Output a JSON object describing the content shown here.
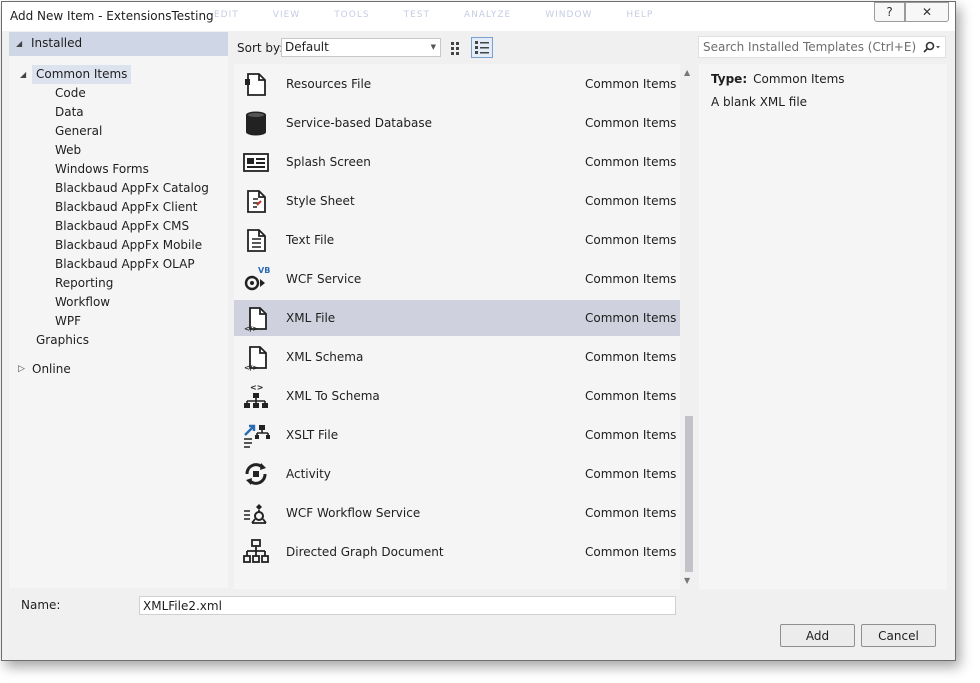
{
  "window": {
    "title": "Add New Item - ExtensionsTesting",
    "ghost_menu": [
      "EDIT",
      "VIEW",
      "TOOLS",
      "TEST",
      "ANALYZE",
      "WINDOW",
      "HELP"
    ],
    "help_label": "?",
    "close_label": "✕"
  },
  "tree": {
    "installed": "Installed",
    "common_items": "Common Items",
    "children": [
      "Code",
      "Data",
      "General",
      "Web",
      "Windows Forms",
      "Blackbaud AppFx Catalog",
      "Blackbaud AppFx Client",
      "Blackbaud AppFx CMS",
      "Blackbaud AppFx Mobile",
      "Blackbaud AppFx OLAP",
      "Reporting",
      "Workflow",
      "WPF"
    ],
    "graphics": "Graphics",
    "online": "Online"
  },
  "toolbar": {
    "sort_label": "Sort by:",
    "sort_value": "Default",
    "view_modes": [
      "small-icons-view-icon",
      "list-view-icon"
    ],
    "active_view": "list-view-icon"
  },
  "search": {
    "placeholder": "Search Installed Templates (Ctrl+E)"
  },
  "templates": [
    {
      "name": "Resources File",
      "category": "Common Items",
      "icon": "resources-file-icon"
    },
    {
      "name": "Service-based Database",
      "category": "Common Items",
      "icon": "database-icon"
    },
    {
      "name": "Splash Screen",
      "category": "Common Items",
      "icon": "splash-screen-icon"
    },
    {
      "name": "Style Sheet",
      "category": "Common Items",
      "icon": "style-sheet-icon"
    },
    {
      "name": "Text File",
      "category": "Common Items",
      "icon": "text-file-icon"
    },
    {
      "name": "WCF Service",
      "category": "Common Items",
      "icon": "wcf-service-icon"
    },
    {
      "name": "XML File",
      "category": "Common Items",
      "icon": "xml-file-icon",
      "selected": true
    },
    {
      "name": "XML Schema",
      "category": "Common Items",
      "icon": "xml-schema-icon"
    },
    {
      "name": "XML To Schema",
      "category": "Common Items",
      "icon": "xml-to-schema-icon"
    },
    {
      "name": "XSLT File",
      "category": "Common Items",
      "icon": "xslt-file-icon"
    },
    {
      "name": "Activity",
      "category": "Common Items",
      "icon": "activity-icon"
    },
    {
      "name": "WCF Workflow Service",
      "category": "Common Items",
      "icon": "wcf-workflow-icon"
    },
    {
      "name": "Directed Graph Document",
      "category": "Common Items",
      "icon": "directed-graph-icon"
    }
  ],
  "details": {
    "type_label": "Type:",
    "type_value": "Common Items",
    "description": "A blank XML file"
  },
  "footer": {
    "name_label": "Name:",
    "name_value": "XMLFile2.xml",
    "add_label": "Add",
    "cancel_label": "Cancel"
  },
  "colors": {
    "selection": "#cfd2de",
    "header": "#cfd6e5",
    "icon_blue": "#2b6bb3"
  }
}
